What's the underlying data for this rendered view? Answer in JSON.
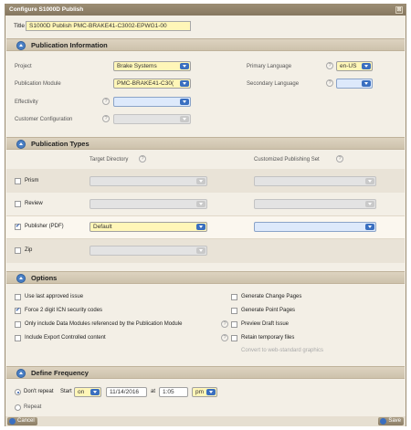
{
  "dialog": {
    "title": "Configure S1000D Publish",
    "close_glyph": "⊠"
  },
  "title_field": {
    "label": "Title",
    "value": "S1000D Publish PMC-BRAKE41-C3002-EPWG1-00"
  },
  "publication_information": {
    "heading": "Publication Information",
    "project": {
      "label": "Project",
      "value": "Brake Systems"
    },
    "publication_module": {
      "label": "Publication Module",
      "value": "PMC-BRAKE41-C30("
    },
    "effectivity": {
      "label": "Effectivity",
      "value": ""
    },
    "customer_configuration": {
      "label": "Customer Configuration",
      "value": ""
    },
    "primary_language": {
      "label": "Primary Language",
      "value": "en-US"
    },
    "secondary_language": {
      "label": "Secondary Language",
      "value": ""
    }
  },
  "publication_types": {
    "heading": "Publication Types",
    "col_target": "Target Directory",
    "col_custom": "Customized Publishing Set",
    "rows": [
      {
        "label": "Prism",
        "checked": false,
        "target": "",
        "custom": ""
      },
      {
        "label": "Review",
        "checked": false,
        "target": "",
        "custom": ""
      },
      {
        "label": "Publisher (PDF)",
        "checked": true,
        "target": "Default",
        "custom": ""
      },
      {
        "label": "Zip",
        "checked": false,
        "target": "",
        "custom": ""
      }
    ]
  },
  "options": {
    "heading": "Options",
    "left": [
      {
        "label": "Use last approved issue",
        "checked": false
      },
      {
        "label": "Force 2 digit ICN security codes",
        "checked": true
      },
      {
        "label": "Only include Data Modules referenced by the Publication Module",
        "checked": false
      },
      {
        "label": "Include Export Controlled content",
        "checked": false
      }
    ],
    "right": [
      {
        "label": "Generate Change Pages",
        "checked": false
      },
      {
        "label": "Generate Point Pages",
        "checked": false
      },
      {
        "label": "Preview Draft Issue",
        "checked": false
      },
      {
        "label": "Retain temporary files",
        "checked": false
      }
    ],
    "disabled_note": "Convert to web-standard graphics"
  },
  "define_frequency": {
    "heading": "Define Frequency",
    "dont_repeat": "Don't repeat",
    "start_label": "Start",
    "start_on": "on",
    "date": "11/14/2016",
    "at_label": "at",
    "time": "1:05",
    "ampm": "pm",
    "repeat": "Repeat"
  },
  "footer": {
    "cancel": "Cancel",
    "save": "Save"
  },
  "colors": {
    "accent": "#3a6fc0",
    "highlight": "#fff6b8",
    "panel": "#f3efe6",
    "header": "#cdc2ac"
  }
}
